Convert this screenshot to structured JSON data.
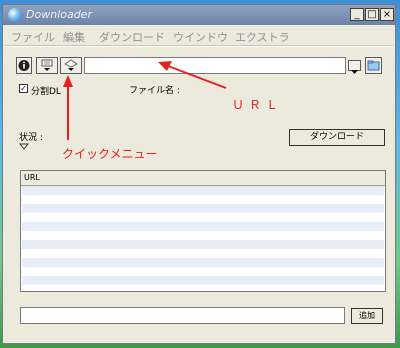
{
  "window": {
    "title": "Downloader",
    "min": "_",
    "max": "□",
    "close": "×"
  },
  "menu": [
    "ファイル",
    "編集",
    "ダウンロード",
    "ウインドウ",
    "エクストラ"
  ],
  "toolbar": {
    "url_value": "",
    "file_name_label": "ファイル名 :"
  },
  "split_dl": {
    "label": "分割DL",
    "checked": true
  },
  "status": {
    "label": "状況 :"
  },
  "download_button": "ダウンロード",
  "list": {
    "columns": [
      "URL"
    ],
    "rows": []
  },
  "bottom": {
    "input_value": "",
    "add_button": "追加"
  },
  "annotations": {
    "url": "ＵＲＬ",
    "quick_menu": "クイックメニュー"
  },
  "colors": {
    "annotation": "#e52020",
    "title_bar": "#7a8fb4",
    "row_alt": "#e6edf7"
  }
}
